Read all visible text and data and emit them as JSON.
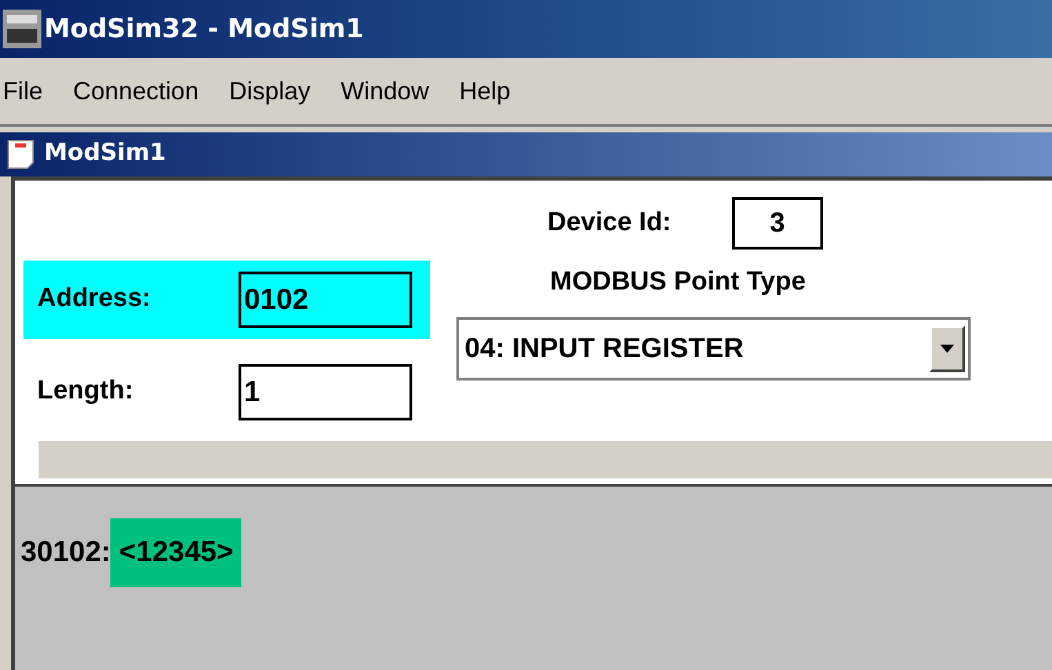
{
  "window": {
    "title": "ModSim32 - ModSim1"
  },
  "menu": [
    "File",
    "Connection",
    "Display",
    "Window",
    "Help"
  ],
  "child_window": {
    "title": "ModSim1"
  },
  "fields": [
    {
      "label": "Address:",
      "value": "0102",
      "highlighted": true
    },
    {
      "label": "Length:",
      "value": "1",
      "highlighted": false
    }
  ],
  "device_id": {
    "label": "Device Id:",
    "value": "3"
  },
  "point_type": {
    "label": "MODBUS Point Type",
    "value": "04: INPUT REGISTER"
  },
  "registers": [
    {
      "address": "30102:",
      "value": "<12345>",
      "highlighted": true
    }
  ]
}
